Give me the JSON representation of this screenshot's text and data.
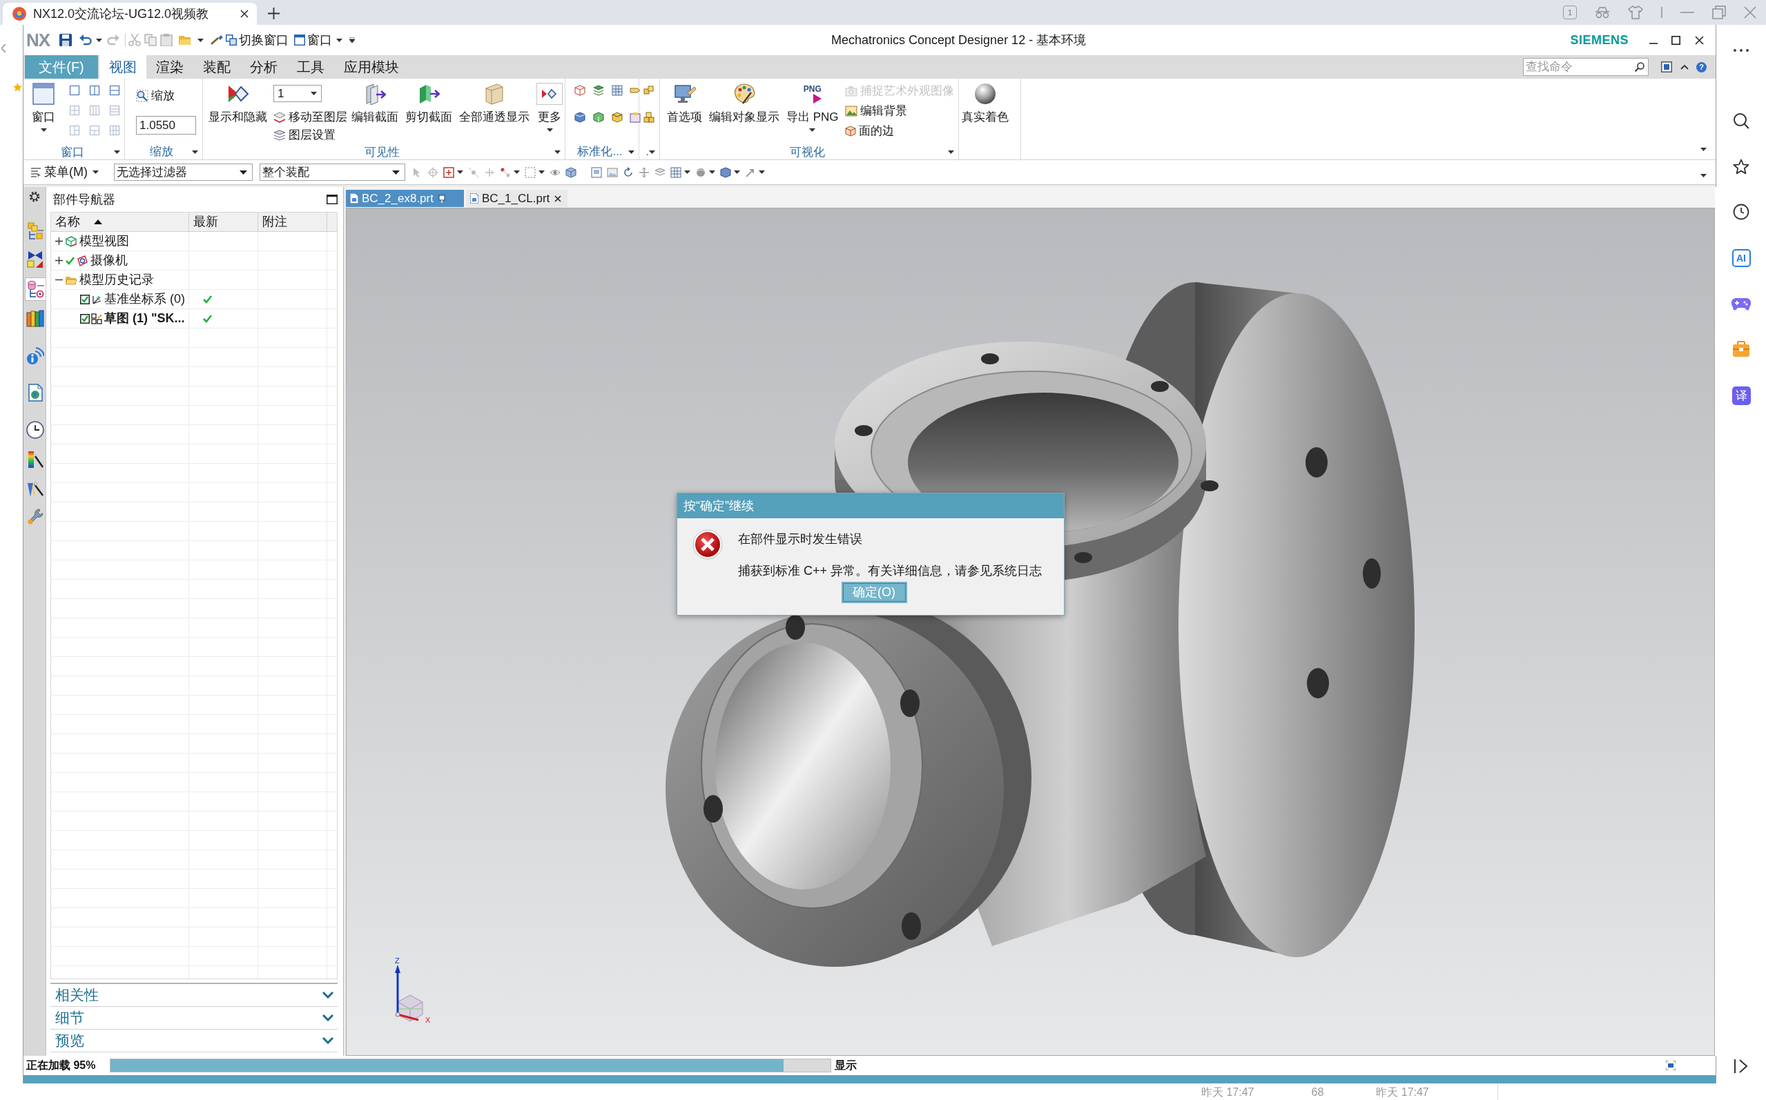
{
  "browser": {
    "tab_title": "NX12.0交流论坛-UG12.0视频教",
    "badge": "1",
    "sidebar": {
      "ai_tile": "AI",
      "translate_tile": "译"
    },
    "page_strip": [
      "昨天 17:47",
      "68",
      "昨天 17:47"
    ]
  },
  "window": {
    "logo": "NX",
    "quick_access": [
      {
        "label": "切换窗口",
        "has_menu": false
      },
      {
        "label": "窗口",
        "has_menu": true
      }
    ],
    "title": "Mechatronics Concept Designer 12 - 基本环境",
    "brand": "SIEMENS"
  },
  "menu": {
    "file": "文件(F)",
    "tabs": [
      {
        "label": "视图",
        "selected": true
      },
      {
        "label": "渲染",
        "selected": false
      },
      {
        "label": "装配",
        "selected": false
      },
      {
        "label": "分析",
        "selected": false
      },
      {
        "label": "工具",
        "selected": false
      },
      {
        "label": "应用模块",
        "selected": false
      }
    ],
    "search": {
      "placeholder": "查找命令"
    },
    "help": "?"
  },
  "ribbon": {
    "groups": [
      {
        "label": "窗口",
        "items": [
          {
            "kind": "large",
            "label": "窗口",
            "has_menu": true
          },
          {
            "kind": "layout_grid"
          }
        ]
      },
      {
        "label": "缩放",
        "items": [
          {
            "kind": "stack",
            "items": [
              {
                "kind": "small",
                "label": "缩放"
              },
              {
                "kind": "input",
                "value": "1.0550"
              }
            ]
          }
        ]
      },
      {
        "label": "可见性",
        "items": [
          {
            "kind": "large",
            "label": "显示和隐藏",
            "has_menu": false
          },
          {
            "kind": "stack",
            "items": [
              {
                "kind": "select",
                "value": "1"
              },
              {
                "kind": "small",
                "label": "移动至图层"
              },
              {
                "kind": "small",
                "label": "图层设置"
              }
            ]
          },
          {
            "kind": "large",
            "label": "编辑截面",
            "has_menu": false
          },
          {
            "kind": "large",
            "label": "剪切截面",
            "has_menu": false
          },
          {
            "kind": "large",
            "label": "全部通透显示",
            "has_menu": false
          },
          {
            "kind": "gallery",
            "label": "更多",
            "has_menu": true
          }
        ]
      },
      {
        "label": "标准化...",
        "items": [
          {
            "kind": "tool_grid"
          }
        ]
      },
      {
        "label": ".",
        "items": [
          {
            "kind": "tool_column"
          }
        ]
      },
      {
        "label": "可视化",
        "items": [
          {
            "kind": "large",
            "label": "首选项",
            "has_menu": false
          },
          {
            "kind": "large",
            "label": "编辑对象显示",
            "has_menu": false
          },
          {
            "kind": "large",
            "label": "导出 PNG",
            "has_menu": true,
            "icon_text": "PNG"
          },
          {
            "kind": "stack",
            "items": [
              {
                "kind": "small",
                "label": "捕捉艺术外观图像",
                "disabled": true
              },
              {
                "kind": "small",
                "label": "编辑背景",
                "disabled": false
              },
              {
                "kind": "small",
                "label": "面的边",
                "disabled": false
              }
            ]
          }
        ]
      },
      {
        "items": [
          {
            "kind": "large",
            "label": "真实着色",
            "has_menu": false
          }
        ]
      }
    ]
  },
  "toolbar": {
    "menu_button": "菜单(M)",
    "selects": [
      {
        "value": "无选择过滤器"
      },
      {
        "value": "整个装配"
      }
    ]
  },
  "resource_bar": {
    "tabs": [
      {
        "selected": false
      },
      {
        "selected": false
      },
      {
        "selected": true
      },
      {
        "selected": false
      },
      {
        "selected": false
      },
      {
        "selected": false
      },
      {
        "selected": false
      },
      {
        "selected": false
      },
      {
        "selected": false
      },
      {
        "selected": false
      }
    ]
  },
  "navigator": {
    "title": "部件导航器",
    "columns": [
      {
        "label": "名称",
        "sorted": true
      },
      {
        "label": "最新",
        "sorted": false
      },
      {
        "label": "附注",
        "sorted": false
      }
    ],
    "tree": [
      {
        "name": "模型视图",
        "expanded": false,
        "checked": false,
        "up_to_date": false
      },
      {
        "name": "摄像机",
        "expanded": false,
        "checked": true,
        "up_to_date": false
      },
      {
        "name": "模型历史记录",
        "expanded": true,
        "checked": false,
        "up_to_date": false,
        "children": [
          {
            "name": "基准坐标系 (0)",
            "checked": true,
            "current": false,
            "up_to_date": true
          },
          {
            "name": "草图 (1) \"SK...",
            "checked": true,
            "current": true,
            "up_to_date": true
          }
        ]
      }
    ],
    "sections": [
      {
        "label": "相关性",
        "expanded": false
      },
      {
        "label": "细节",
        "expanded": false
      },
      {
        "label": "预览",
        "expanded": false
      }
    ]
  },
  "graphics": {
    "tabs": [
      {
        "label": "BC_2_ex8.prt",
        "selected": true
      },
      {
        "label": "BC_1_CL.prt",
        "selected": false
      }
    ],
    "triad": {
      "z": "Z",
      "x": "X"
    }
  },
  "dialog": {
    "title": "按“确定”继续",
    "message": "在部件显示时发生错误",
    "detail": "捕获到标准 C++ 异常。有关详细信息，请参见系统日志",
    "button": "确定(O)"
  },
  "status_bar": {
    "text": "正在加载 95%",
    "progress": {
      "level": 0.934
    },
    "mode": "显示"
  }
}
